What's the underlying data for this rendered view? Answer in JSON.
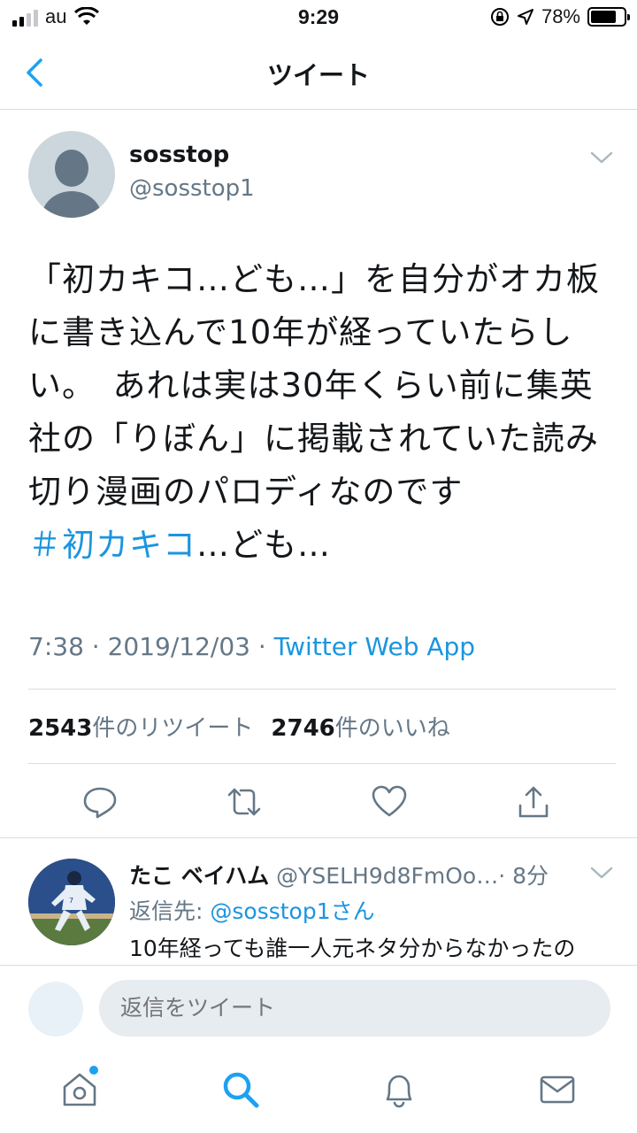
{
  "status_bar": {
    "carrier": "au",
    "time": "9:29",
    "battery": "78%"
  },
  "nav": {
    "title": "ツイート"
  },
  "tweet": {
    "display_name": "sosstop",
    "handle": "@sosstop1",
    "text": "「初カキコ…ども…」を自分がオカ板に書き込んで10年が経っていたらしい。　あれは実は30年くらい前に集英社の「りぼん」に掲載されていた読み切り漫画のパロディなのです",
    "hashtag": "＃初カキコ",
    "hashtag_suffix": "…ども…",
    "timestamp": "7:38 · 2019/12/03 · ",
    "source": "Twitter Web App",
    "retweet_count": "2543",
    "retweet_label": "件のリツイート",
    "like_count": "2746",
    "like_label": "件のいいね"
  },
  "reply": {
    "display_name": "たこ ベイハム",
    "handle": " @YSELH9d8FmOo…",
    "time": "· 8分",
    "reply_to_label": "返信先: ",
    "reply_to_user": "@sosstop1さん",
    "text": "10年経っても誰一人元ネタ分からなかったの"
  },
  "composer": {
    "placeholder": "返信をツイート"
  },
  "colors": {
    "accent": "#1da1f2",
    "link": "#1b95e0",
    "secondary_text": "#657786"
  }
}
